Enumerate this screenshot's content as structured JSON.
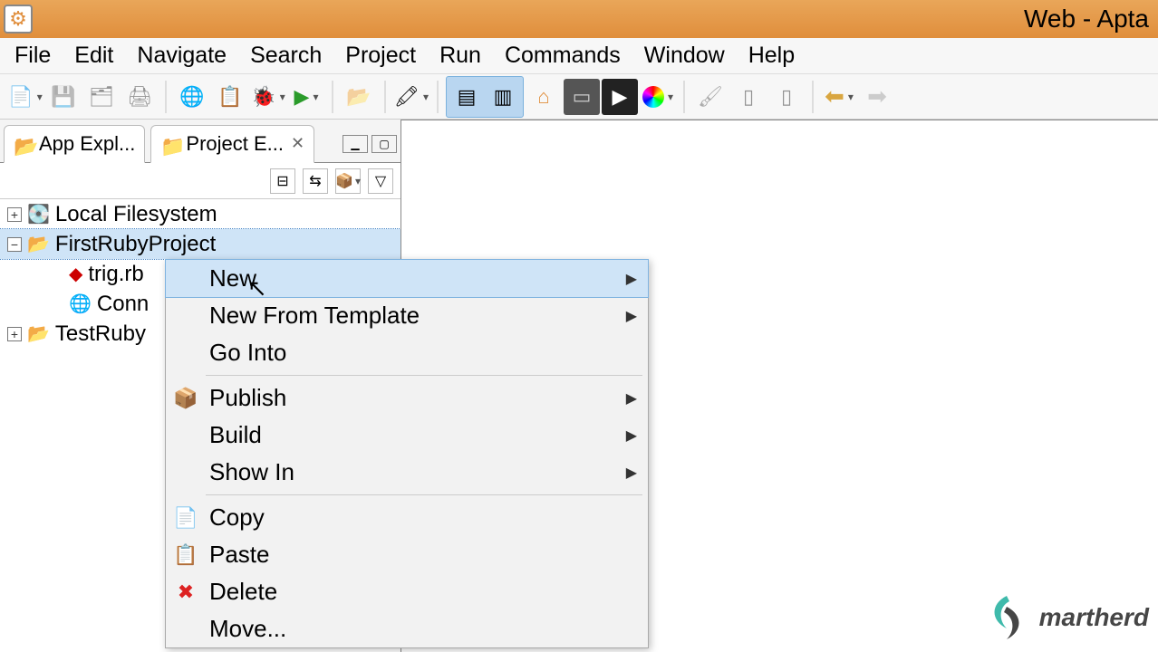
{
  "titlebar": {
    "title": "Web - Apta"
  },
  "menubar": {
    "items": [
      "File",
      "Edit",
      "Navigate",
      "Search",
      "Project",
      "Run",
      "Commands",
      "Window",
      "Help"
    ]
  },
  "tabs": {
    "app_explorer_label": "App Expl...",
    "project_explorer_label": "Project E..."
  },
  "tree": {
    "local_fs": "Local Filesystem",
    "project1": "FirstRubyProject",
    "file1": "trig.rb",
    "conn": "Conn",
    "project2": "TestRuby"
  },
  "context_menu": {
    "new": "New",
    "new_from_template": "New From Template",
    "go_into": "Go Into",
    "publish": "Publish",
    "build": "Build",
    "show_in": "Show In",
    "copy": "Copy",
    "paste": "Paste",
    "delete": "Delete",
    "move": "Move..."
  },
  "watermark": {
    "text": "martherd"
  }
}
